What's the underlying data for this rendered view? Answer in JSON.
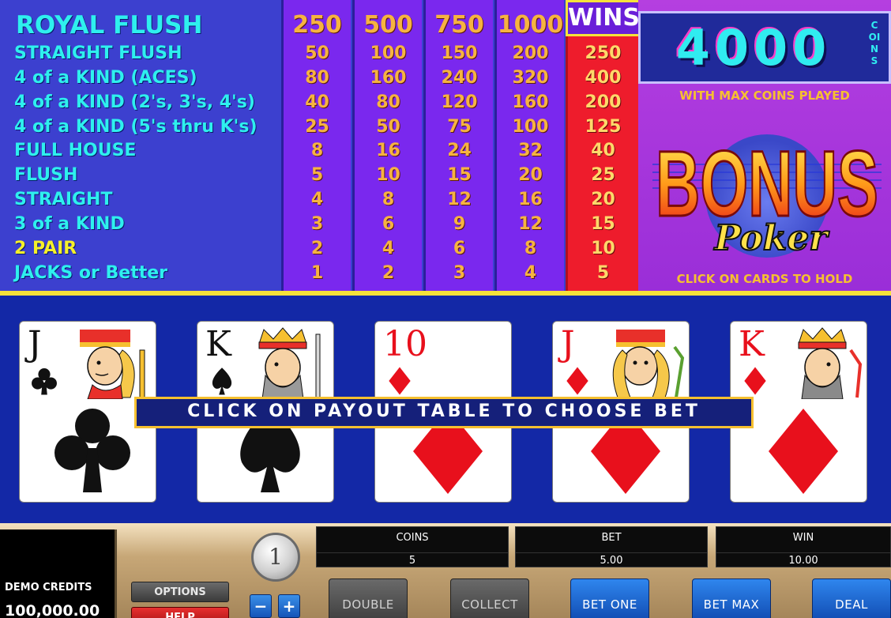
{
  "paytable": {
    "hands": [
      {
        "name": "ROYAL FLUSH",
        "payouts": [
          "250",
          "500",
          "750",
          "1000"
        ]
      },
      {
        "name": "STRAIGHT FLUSH",
        "payouts": [
          "50",
          "100",
          "150",
          "200"
        ],
        "max": "250"
      },
      {
        "name": "4 of a KIND (ACES)",
        "payouts": [
          "80",
          "160",
          "240",
          "320"
        ],
        "max": "400"
      },
      {
        "name": "4 of a KIND (2's, 3's, 4's)",
        "payouts": [
          "40",
          "80",
          "120",
          "160"
        ],
        "max": "200"
      },
      {
        "name": "4 of a KIND (5's thru K's)",
        "payouts": [
          "25",
          "50",
          "75",
          "100"
        ],
        "max": "125"
      },
      {
        "name": "FULL HOUSE",
        "payouts": [
          "8",
          "16",
          "24",
          "32"
        ],
        "max": "40"
      },
      {
        "name": "FLUSH",
        "payouts": [
          "5",
          "10",
          "15",
          "20"
        ],
        "max": "25"
      },
      {
        "name": "STRAIGHT",
        "payouts": [
          "4",
          "8",
          "12",
          "16"
        ],
        "max": "20"
      },
      {
        "name": "3 of a KIND",
        "payouts": [
          "3",
          "6",
          "9",
          "12"
        ],
        "max": "15"
      },
      {
        "name": "2 PAIR",
        "payouts": [
          "2",
          "4",
          "6",
          "8"
        ],
        "max": "10"
      },
      {
        "name": "JACKS or Better",
        "payouts": [
          "1",
          "2",
          "3",
          "4"
        ],
        "max": "5"
      }
    ],
    "wins_label": "WINS",
    "top_win": "4000",
    "top_win_unit": "COINS",
    "max_coins_text": "WITH MAX COINS PLAYED",
    "logo_word": "BONUS",
    "logo_sub": "Poker",
    "hold_text": "CLICK ON CARDS TO HOLD"
  },
  "cards": [
    {
      "rank": "J",
      "suit": "clubs",
      "color": "black",
      "face": "jack"
    },
    {
      "rank": "K",
      "suit": "spades",
      "color": "black",
      "face": "king"
    },
    {
      "rank": "10",
      "suit": "diamonds",
      "color": "red",
      "face": ""
    },
    {
      "rank": "J",
      "suit": "diamonds",
      "color": "red",
      "face": "jack"
    },
    {
      "rank": "K",
      "suit": "diamonds",
      "color": "red",
      "face": "king"
    }
  ],
  "message": "CLICK ON PAYOUT TABLE TO CHOOSE BET",
  "panel": {
    "credits_label": "DEMO CREDITS",
    "credits_value": "100,000.00",
    "options_label": "OPTIONS",
    "help_label": "HELP",
    "coin_value": "1",
    "minus_label": "−",
    "plus_label": "+",
    "coins_label": "COINS",
    "coins_value": "5",
    "bet_label": "BET",
    "bet_value": "5.00",
    "win_label": "WIN",
    "win_value": "10.00",
    "buttons": {
      "double": "DOUBLE",
      "collect": "COLLECT",
      "bet_one": "BET ONE",
      "bet_max": "BET MAX",
      "deal": "DEAL"
    }
  },
  "colors": {
    "cyan_text": "#2ef0ee",
    "orange_text": "#f6b340",
    "wins_column": "#ee1c2c",
    "pay_column": "#7a28ee",
    "felt": "#1328a6",
    "accent_yellow": "#f6e23a"
  }
}
